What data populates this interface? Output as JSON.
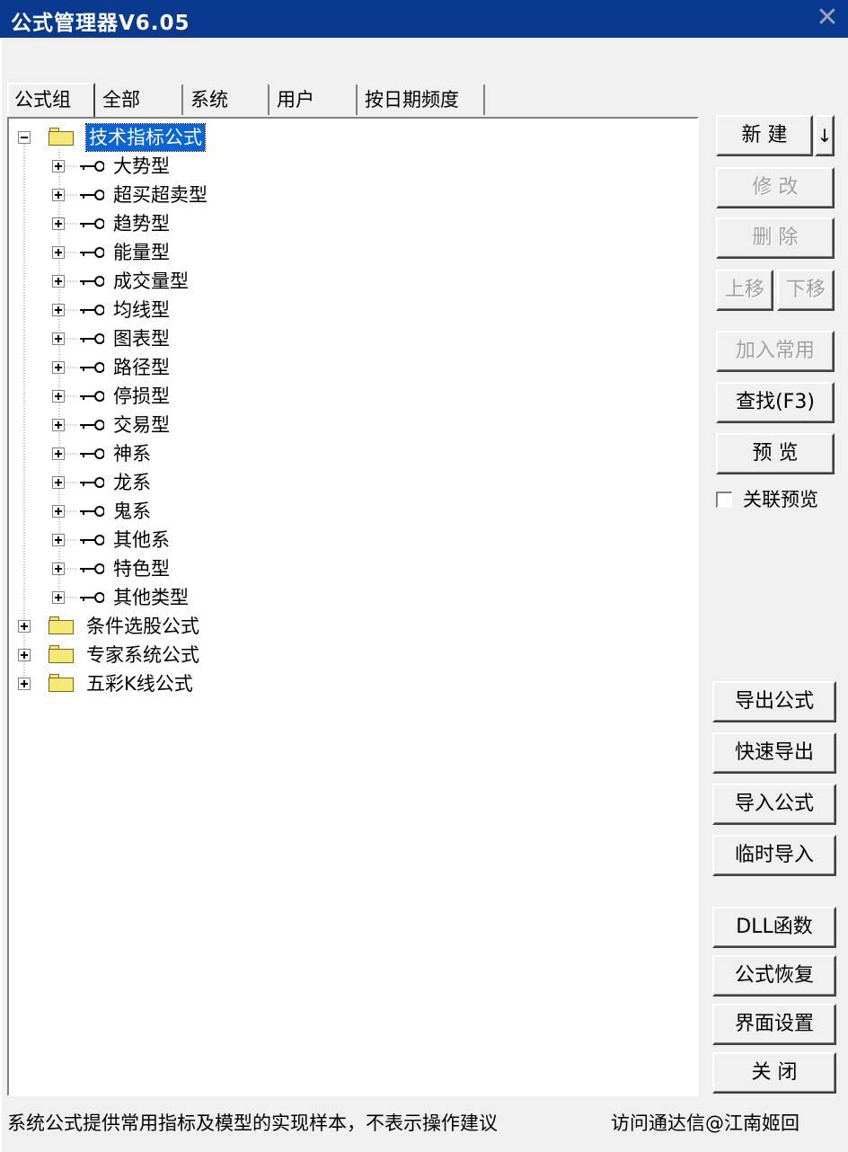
{
  "window": {
    "title": "公式管理器V6.05",
    "close_glyph": "✕"
  },
  "tabs": [
    {
      "label": "公式组",
      "active": true
    },
    {
      "label": "全部",
      "active": false
    },
    {
      "label": "系统",
      "active": false
    },
    {
      "label": "用户",
      "active": false
    },
    {
      "label": "按日期频度",
      "active": false
    }
  ],
  "tree": {
    "root_expanded": {
      "label": "技术指标公式",
      "expanded": true,
      "selected": true,
      "icon": "folder-icon",
      "children": [
        "大势型",
        "超买超卖型",
        "趋势型",
        "能量型",
        "成交量型",
        "均线型",
        "图表型",
        "路径型",
        "停损型",
        "交易型",
        "神系",
        "龙系",
        "鬼系",
        "其他系",
        "特色型",
        "其他类型"
      ],
      "child_icon": "key-icon"
    },
    "other_roots": [
      {
        "label": "条件选股公式",
        "expanded": false
      },
      {
        "label": "专家系统公式",
        "expanded": false
      },
      {
        "label": "五彩K线公式",
        "expanded": false
      }
    ]
  },
  "buttons": {
    "new": "新  建",
    "new_dropdown": "↓",
    "modify": "修 改",
    "delete": "删 除",
    "move_up": "上移",
    "move_down": "下移",
    "add_common": "加入常用",
    "find": "查找(F3)",
    "preview": "预 览",
    "export_formula": "导出公式",
    "quick_export": "快速导出",
    "import_formula": "导入公式",
    "temp_import": "临时导入",
    "dll_functions": "DLL函数",
    "restore_formula": "公式恢复",
    "ui_settings": "界面设置",
    "close": "关 闭"
  },
  "linked_preview": {
    "label": "关联预览",
    "checked": false
  },
  "status": {
    "left": "系统公式提供常用指标及模型的实现样本，不表示操作建议",
    "right": "访问通达信@江南姬回"
  },
  "colors": {
    "titlebar": "#0a3a8f",
    "selection": "#0a64d6",
    "folder": "#f6e777"
  }
}
